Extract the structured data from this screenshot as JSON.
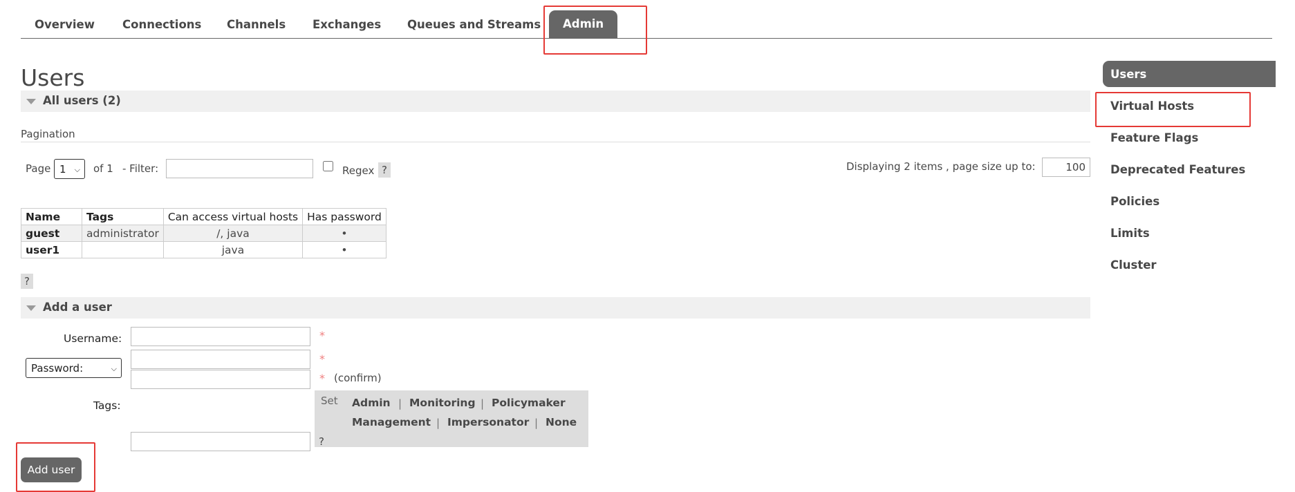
{
  "topnav": {
    "tabs": [
      {
        "label": "Overview"
      },
      {
        "label": "Connections"
      },
      {
        "label": "Channels"
      },
      {
        "label": "Exchanges"
      },
      {
        "label": "Queues and Streams"
      },
      {
        "label": "Admin",
        "active": true
      }
    ]
  },
  "page": {
    "title": "Users"
  },
  "all_users": {
    "header": "All users (2)"
  },
  "pagination": {
    "section_label": "Pagination",
    "page_label": "Page",
    "page_value": "1",
    "of_label": "of 1",
    "filter_label": "- Filter:",
    "filter_value": "",
    "regex_label": "Regex",
    "help": "?",
    "displaying_label": "Displaying 2 items , page size up to:",
    "page_size": "100"
  },
  "users_table": {
    "headers": [
      "Name",
      "Tags",
      "Can access virtual hosts",
      "Has password"
    ],
    "rows": [
      {
        "name": "guest",
        "tags": "administrator",
        "vhosts": "/, java",
        "has_password": "•"
      },
      {
        "name": "user1",
        "tags": "",
        "vhosts": "java",
        "has_password": "•"
      }
    ],
    "help": "?"
  },
  "add_user": {
    "header": "Add a user",
    "username_label": "Username:",
    "password_type": "Password:",
    "required_mark": "*",
    "confirm_label": "(confirm)",
    "tags_label": "Tags:",
    "set_label": "Set",
    "tags_help": "?",
    "tag_options": [
      "Admin",
      "Monitoring",
      "Policymaker",
      "Management",
      "Impersonator",
      "None"
    ],
    "separator": "|",
    "submit_label": "Add user"
  },
  "sidenav": {
    "items": [
      "Users",
      "Virtual Hosts",
      "Feature Flags",
      "Deprecated Features",
      "Policies",
      "Limits",
      "Cluster"
    ],
    "active": "Users"
  },
  "colors": {
    "accent": "#666666",
    "highlight": "#e53935",
    "required": "#f08080"
  }
}
